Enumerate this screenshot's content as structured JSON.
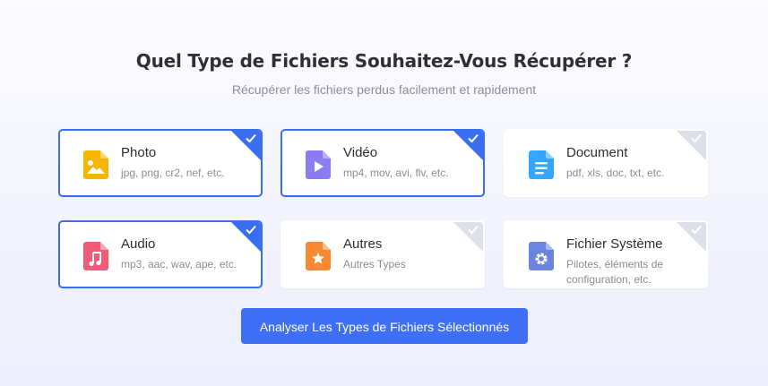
{
  "header": {
    "title": "Quel Type de Fichiers Souhaitez-Vous Récupérer ?",
    "subtitle": "Récupérer les fichiers perdus facilement et rapidement"
  },
  "file_types": [
    {
      "name": "Photo",
      "desc": "jpg, png, cr2, nef, etc.",
      "icon": "image-file-icon",
      "color": "#f7b500",
      "selected": true
    },
    {
      "name": "Vidéo",
      "desc": "mp4, mov, avi, flv, etc.",
      "icon": "video-file-icon",
      "color": "#8b7cf4",
      "selected": true
    },
    {
      "name": "Document",
      "desc": "pdf, xls, doc, txt, etc.",
      "icon": "document-file-icon",
      "color": "#33a6ff",
      "selected": false
    },
    {
      "name": "Audio",
      "desc": "mp3, aac, wav, ape, etc.",
      "icon": "audio-file-icon",
      "color": "#f25b78",
      "selected": true
    },
    {
      "name": "Autres",
      "desc": "Autres Types",
      "icon": "other-file-icon",
      "color": "#f98832",
      "selected": false
    },
    {
      "name": "Fichier Système",
      "desc": "Pilotes, éléments de configuration, etc.",
      "icon": "system-file-icon",
      "color": "#6b84dd",
      "selected": false
    }
  ],
  "actions": {
    "scan_label": "Analyser Les Types de Fichiers Sélectionnés"
  },
  "colors": {
    "accent": "#3a6ef0",
    "unselected_corner": "#dde0e8"
  }
}
